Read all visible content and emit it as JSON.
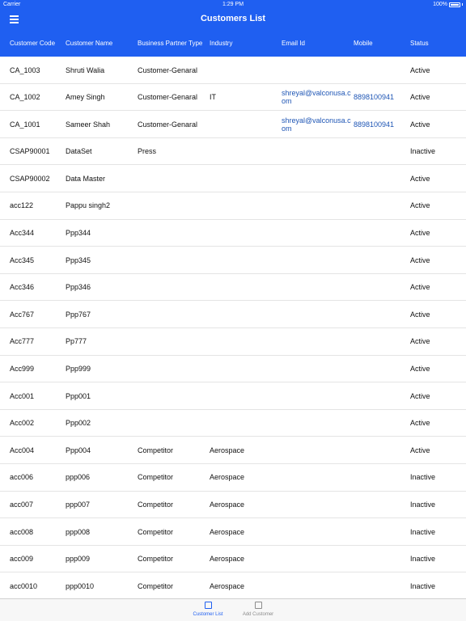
{
  "status_bar": {
    "carrier": "Carrier",
    "time": "1:29 PM",
    "battery": "100%"
  },
  "nav": {
    "title": "Customers List",
    "menu_icon": "hamburger-menu-icon"
  },
  "columns": [
    "Customer Code",
    "Customer Name",
    "Business Partner Type",
    "Industry",
    "Email Id",
    "Mobile",
    "Status"
  ],
  "rows": [
    [
      "CA_1003",
      "Shruti Walia",
      "Customer-Genaral",
      "",
      "",
      "",
      "Active"
    ],
    [
      "CA_1002",
      "Amey Singh",
      "Customer-Genaral",
      "IT",
      "shreyal@valconusa.com",
      "8898100941",
      "Active"
    ],
    [
      "CA_1001",
      "Sameer Shah",
      "Customer-Genaral",
      "",
      "shreyal@valconusa.com",
      "8898100941",
      "Active"
    ],
    [
      "CSAP90001",
      "DataSet",
      "Press",
      "",
      "",
      "",
      "Inactive"
    ],
    [
      "CSAP90002",
      "Data Master",
      "",
      "",
      "",
      "",
      "Active"
    ],
    [
      "acc122",
      "Pappu singh2",
      "",
      "",
      "",
      "",
      "Active"
    ],
    [
      "Acc344",
      "Ppp344",
      "",
      "",
      "",
      "",
      "Active"
    ],
    [
      "Acc345",
      "Ppp345",
      "",
      "",
      "",
      "",
      "Active"
    ],
    [
      "Acc346",
      "Ppp346",
      "",
      "",
      "",
      "",
      "Active"
    ],
    [
      "Acc767",
      "Ppp767",
      "",
      "",
      "",
      "",
      "Active"
    ],
    [
      "Acc777",
      "Pp777",
      "",
      "",
      "",
      "",
      "Active"
    ],
    [
      "Acc999",
      "Ppp999",
      "",
      "",
      "",
      "",
      "Active"
    ],
    [
      "Acc001",
      "Ppp001",
      "",
      "",
      "",
      "",
      "Active"
    ],
    [
      "Acc002",
      "Ppp002",
      "",
      "",
      "",
      "",
      "Active"
    ],
    [
      "Acc004",
      "Ppp004",
      "Competitor",
      "Aerospace",
      "",
      "",
      "Active"
    ],
    [
      "acc006",
      "ppp006",
      "Competitor",
      "Aerospace",
      "",
      "",
      "Inactive"
    ],
    [
      "acc007",
      "ppp007",
      "Competitor",
      "Aerospace",
      "",
      "",
      "Inactive"
    ],
    [
      "acc008",
      "ppp008",
      "Competitor",
      "Aerospace",
      "",
      "",
      "Inactive"
    ],
    [
      "acc009",
      "ppp009",
      "Competitor",
      "Aerospace",
      "",
      "",
      "Inactive"
    ],
    [
      "acc0010",
      "ppp0010",
      "Competitor",
      "Aerospace",
      "",
      "",
      "Inactive"
    ]
  ],
  "tabs": [
    {
      "label": "Customer List",
      "icon": "list-tab-icon",
      "active": true
    },
    {
      "label": "Add Customer",
      "icon": "add-customer-tab-icon",
      "active": false
    }
  ],
  "colors": {
    "primary": "#1f5ff1",
    "link": "#1f56b5",
    "divider": "#e4e4e4"
  }
}
